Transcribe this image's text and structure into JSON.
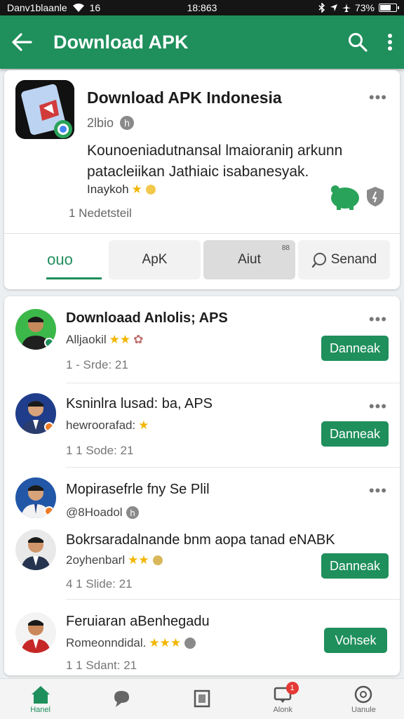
{
  "status_bar": {
    "carrier": "Danv1blaanle",
    "signal": "16",
    "time": "18:863",
    "battery": "73%",
    "battery_level": 0.73
  },
  "appbar": {
    "title": "Download APK"
  },
  "featured": {
    "title": "Download APK Indonesia",
    "subtitle": "2lbio",
    "description": "Kounoeniadutnansal lmaioraniŋ arkunn patacleiikan Jathiaic isabanesyak.",
    "rating_text": "Inaykoh",
    "meta": "1   Nedetsteil"
  },
  "tabs": [
    {
      "label": "ouo"
    },
    {
      "label": "ApK"
    },
    {
      "label": "Aiut",
      "badge": "88"
    },
    {
      "label": "Senand"
    }
  ],
  "list": [
    {
      "title": "Downloaad Anlolis; APS",
      "line2": "Alljaokil",
      "meta": "1 - Srde: 21",
      "button": "Danneak"
    },
    {
      "title": "Ksninlra lusad: ba, APS",
      "line2": "hewroorafad:",
      "meta": "1 1 Sode: 21",
      "button": "Danneak"
    },
    {
      "title": "Mopirasefrle fny Se Plil",
      "line2": "@8Hoadol",
      "meta": "",
      "button": ""
    },
    {
      "title": "Bokrsaradalnande bnm aopa tanad eNABK",
      "line2": "2oyhenbarl",
      "meta": "4 1 Slide: 21",
      "button": "Danneak"
    },
    {
      "title": "Feruiaran aBenhegadu",
      "line2": "Romeonndidal.",
      "meta": "1 1 Sdant: 21",
      "button": "Vohsek"
    }
  ],
  "bottom_nav": [
    {
      "label": "Hanel",
      "icon": "home-icon"
    },
    {
      "label": "",
      "icon": "chat-icon"
    },
    {
      "label": "",
      "icon": "library-icon"
    },
    {
      "label": "Alonk",
      "icon": "notification-icon",
      "badge": "1"
    },
    {
      "label": "Uanule",
      "icon": "settings-icon"
    }
  ],
  "colors": {
    "primary": "#1f8f5c",
    "accent": "#f2b600",
    "badge": "#e53935"
  }
}
